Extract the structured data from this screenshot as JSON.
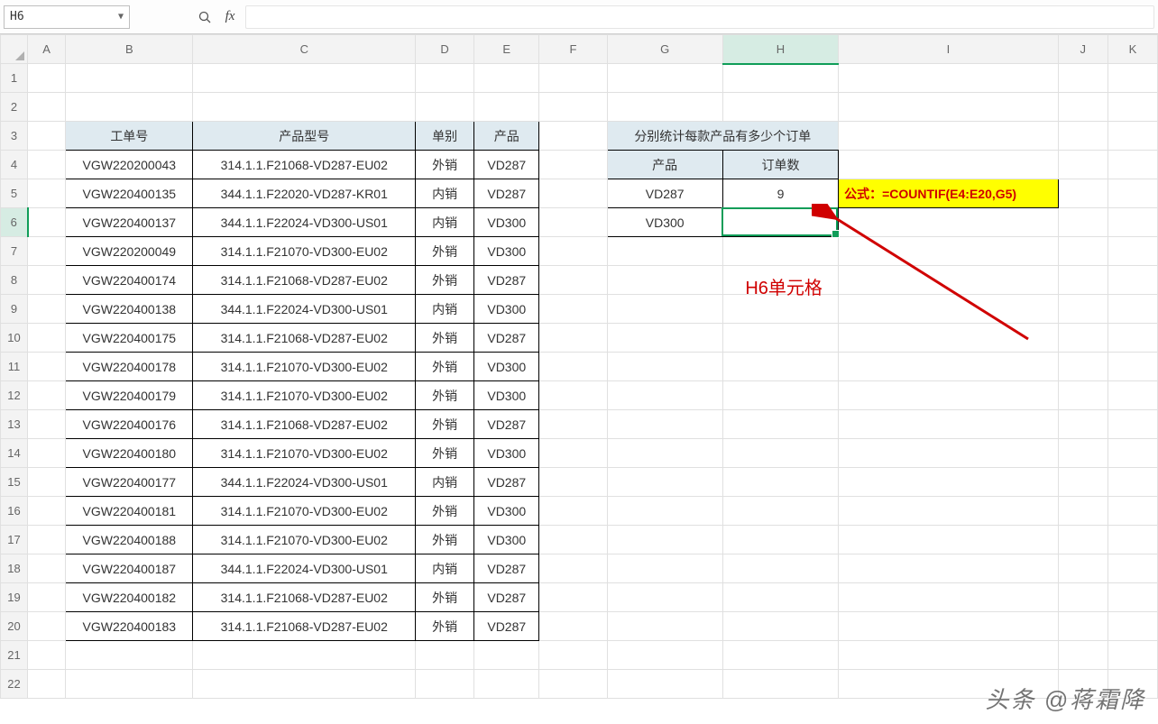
{
  "nameBox": "H6",
  "fx": "fx",
  "columns": [
    "A",
    "B",
    "C",
    "D",
    "E",
    "F",
    "G",
    "H",
    "I",
    "J",
    "K"
  ],
  "activeCol": "H",
  "activeRow": 6,
  "headers": {
    "B": "工单号",
    "C": "产品型号",
    "D": "单别",
    "E": "产品"
  },
  "sideTitle": "分别统计每款产品有多少个订单",
  "sideHeaders": {
    "G": "产品",
    "H": "订单数"
  },
  "sideRows": [
    {
      "product": "VD287",
      "count": "9"
    },
    {
      "product": "VD300",
      "count": ""
    }
  ],
  "formulaBox": "公式：=COUNTIF(E4:E20,G5)",
  "annotation": "H6单元格",
  "watermark": "头条 @蒋霜降",
  "rows": [
    {
      "B": "VGW220200043",
      "C": "314.1.1.F21068-VD287-EU02",
      "D": "外销",
      "E": "VD287"
    },
    {
      "B": "VGW220400135",
      "C": "344.1.1.F22020-VD287-KR01",
      "D": "内销",
      "E": "VD287"
    },
    {
      "B": "VGW220400137",
      "C": "344.1.1.F22024-VD300-US01",
      "D": "内销",
      "E": "VD300"
    },
    {
      "B": "VGW220200049",
      "C": "314.1.1.F21070-VD300-EU02",
      "D": "外销",
      "E": "VD300"
    },
    {
      "B": "VGW220400174",
      "C": "314.1.1.F21068-VD287-EU02",
      "D": "外销",
      "E": "VD287"
    },
    {
      "B": "VGW220400138",
      "C": "344.1.1.F22024-VD300-US01",
      "D": "内销",
      "E": "VD300"
    },
    {
      "B": "VGW220400175",
      "C": "314.1.1.F21068-VD287-EU02",
      "D": "外销",
      "E": "VD287"
    },
    {
      "B": "VGW220400178",
      "C": "314.1.1.F21070-VD300-EU02",
      "D": "外销",
      "E": "VD300"
    },
    {
      "B": "VGW220400179",
      "C": "314.1.1.F21070-VD300-EU02",
      "D": "外销",
      "E": "VD300"
    },
    {
      "B": "VGW220400176",
      "C": "314.1.1.F21068-VD287-EU02",
      "D": "外销",
      "E": "VD287"
    },
    {
      "B": "VGW220400180",
      "C": "314.1.1.F21070-VD300-EU02",
      "D": "外销",
      "E": "VD300"
    },
    {
      "B": "VGW220400177",
      "C": "344.1.1.F22024-VD300-US01",
      "D": "内销",
      "E": "VD287"
    },
    {
      "B": "VGW220400181",
      "C": "314.1.1.F21070-VD300-EU02",
      "D": "外销",
      "E": "VD300"
    },
    {
      "B": "VGW220400188",
      "C": "314.1.1.F21070-VD300-EU02",
      "D": "外销",
      "E": "VD300"
    },
    {
      "B": "VGW220400187",
      "C": "344.1.1.F22024-VD300-US01",
      "D": "内销",
      "E": "VD287"
    },
    {
      "B": "VGW220400182",
      "C": "314.1.1.F21068-VD287-EU02",
      "D": "外销",
      "E": "VD287"
    },
    {
      "B": "VGW220400183",
      "C": "314.1.1.F21068-VD287-EU02",
      "D": "外销",
      "E": "VD287"
    }
  ]
}
